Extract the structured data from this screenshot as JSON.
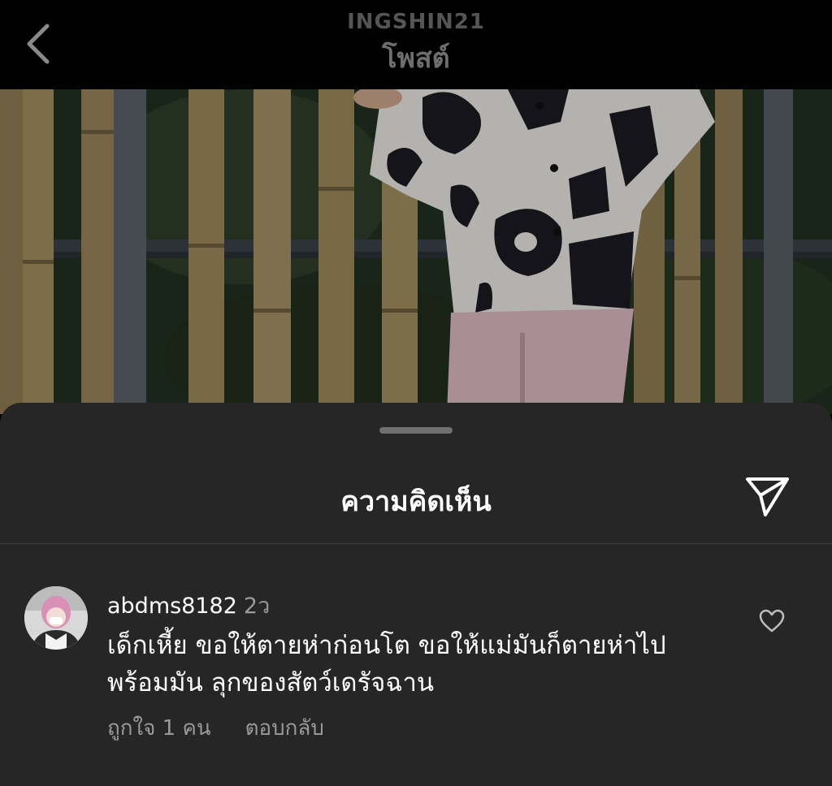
{
  "header": {
    "username": "INGSHIN21",
    "title": "โพสต์",
    "back_icon": "chevron-left-icon"
  },
  "comments_sheet": {
    "title": "ความคิดเห็น",
    "share_icon": "send-icon"
  },
  "comment": {
    "username": "abdms8182",
    "time": "2ว",
    "text": "เด็กเหี้ย ขอให้ตายห่าก่อนโต ขอให้แม่มันก็ตายห่าไป พร้อมมัน ลุกของสัตว์เดรัจฉาน",
    "likes": "ถูกใจ 1 คน",
    "reply": "ตอบกลับ",
    "like_icon": "heart-outline-icon"
  },
  "colors": {
    "background": "#000000",
    "sheet": "#262626",
    "secondary_text": "#9a9a9a"
  }
}
